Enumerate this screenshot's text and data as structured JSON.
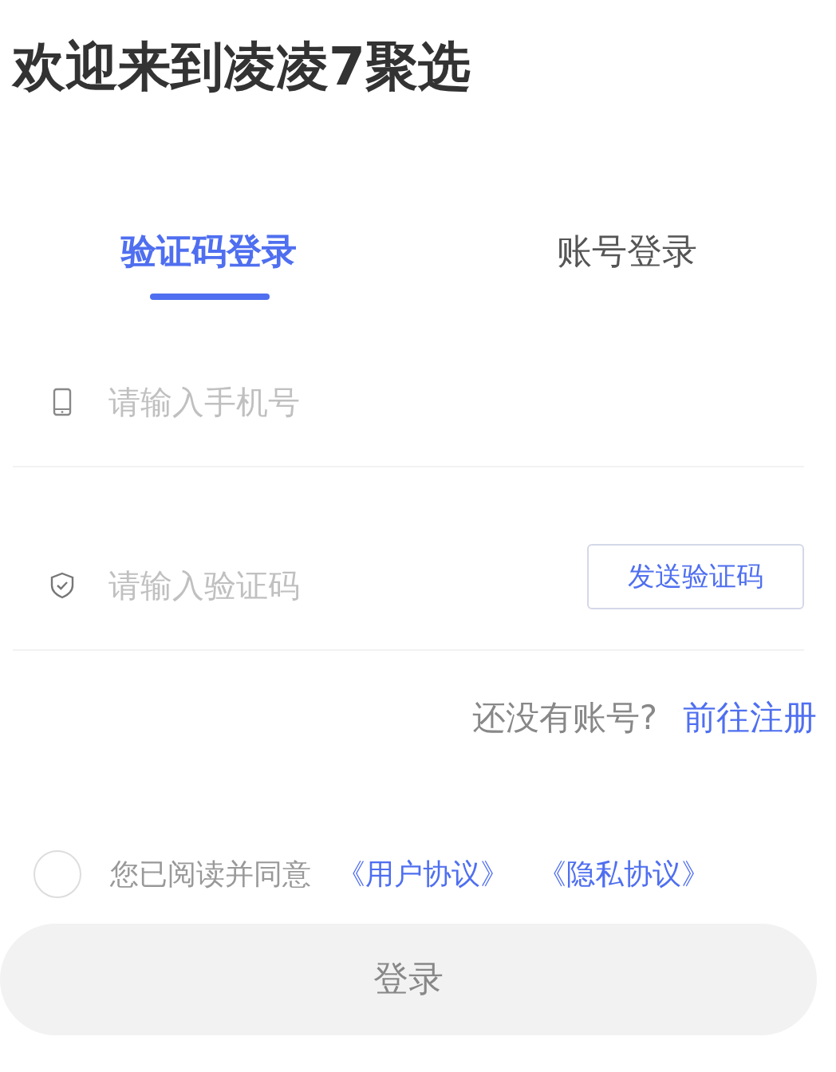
{
  "title": "欢迎来到凌凌7聚选",
  "tabs": [
    {
      "label": "验证码登录",
      "selected": true
    },
    {
      "label": "账号登录",
      "selected": false
    }
  ],
  "phone_field": {
    "placeholder": "请输入手机号"
  },
  "code_field": {
    "placeholder": "请输入验证码"
  },
  "send_code_button": "发送验证码",
  "register_prompt": {
    "text": "还没有账号?",
    "link": "前往注册"
  },
  "agreement": {
    "checked": false,
    "text": "您已阅读并同意",
    "links": [
      "《用户协议》",
      "《隐私协议》"
    ]
  },
  "login_button": "登录"
}
